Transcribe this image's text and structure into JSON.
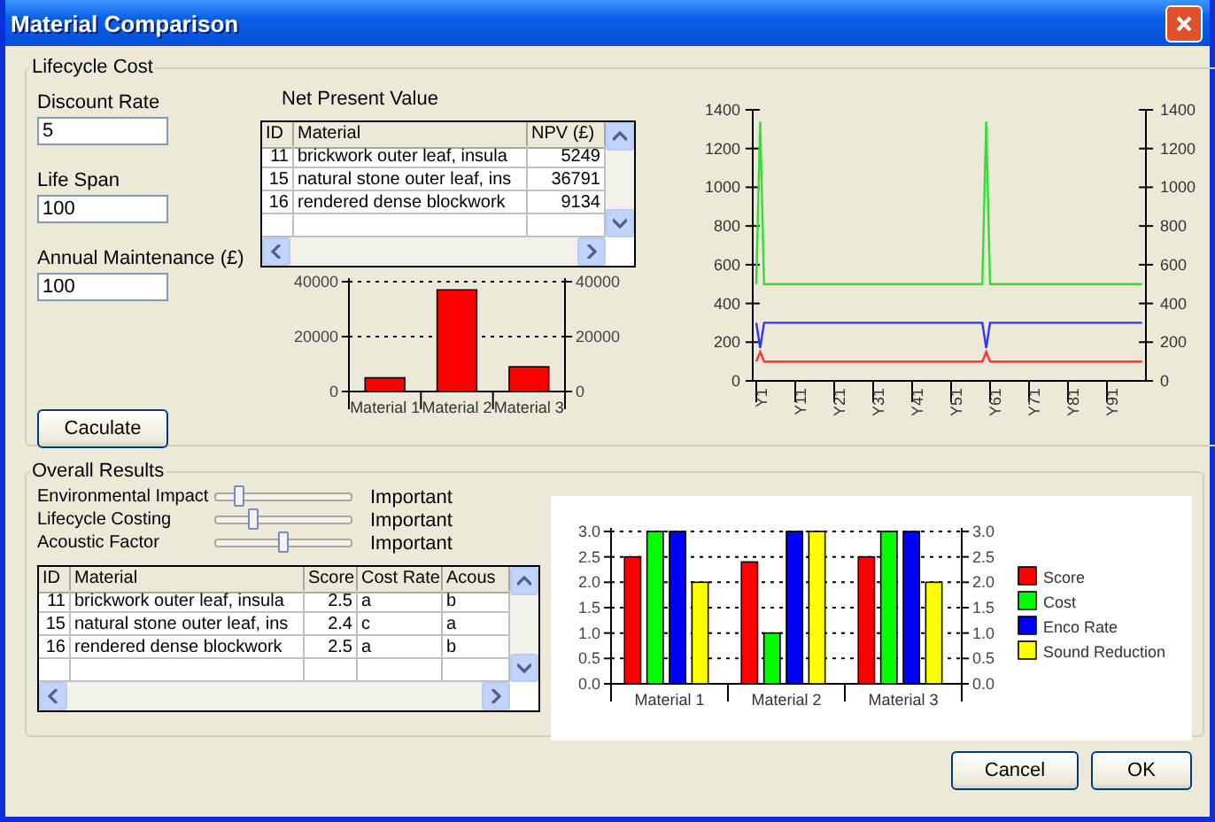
{
  "window": {
    "title": "Material Comparison"
  },
  "lifecycle_cost": {
    "title": "Lifecycle Cost",
    "fields": [
      {
        "label": "Discount Rate",
        "value": "5"
      },
      {
        "label": "Life Span",
        "value": "100"
      },
      {
        "label": "Annual Maintenance (£)",
        "value": "100"
      }
    ],
    "calculate_button": "Caculate",
    "npv_title": "Net Present Value",
    "npv_table": {
      "columns": [
        "ID",
        "Material",
        "NPV (£)"
      ],
      "rows": [
        [
          "11",
          "brickwork outer leaf, insula",
          "5249"
        ],
        [
          "15",
          "natural stone outer leaf, ins",
          "36791"
        ],
        [
          "16",
          "rendered dense blockwork",
          "9134"
        ]
      ]
    },
    "npv_chart": {
      "chart_data": {
        "type": "bar",
        "categories": [
          "Material 1",
          "Material 2",
          "Material 3"
        ],
        "series": [
          {
            "color": "#ff0000",
            "values": [
              5000,
              37000,
              9000
            ]
          }
        ],
        "ylim": [
          0,
          40000
        ],
        "yticks": [
          0,
          20000,
          40000
        ],
        "y2lim": [
          0,
          40000
        ],
        "y2ticks": [
          0,
          20000,
          40000
        ],
        "grid": true
      }
    },
    "trend_chart": {
      "chart_data": {
        "type": "line",
        "ylim": [
          0,
          1400
        ],
        "yticks": [
          0,
          200,
          400,
          600,
          800,
          1000,
          1200,
          1400
        ],
        "y2lim": [
          0,
          1400
        ],
        "y2ticks": [
          0,
          200,
          400,
          600,
          800,
          1000,
          1200,
          1400
        ],
        "categories": [
          "Y1",
          null,
          null,
          null,
          null,
          null,
          null,
          null,
          null,
          null,
          "Y11",
          null,
          null,
          null,
          null,
          null,
          null,
          null,
          null,
          null,
          "Y21",
          null,
          null,
          null,
          null,
          null,
          null,
          null,
          null,
          null,
          "Y31",
          null,
          null,
          null,
          null,
          null,
          null,
          null,
          null,
          null,
          "Y41",
          null,
          null,
          null,
          null,
          null,
          null,
          null,
          null,
          null,
          "Y51",
          null,
          null,
          null,
          null,
          null,
          null,
          null,
          null,
          null,
          "Y61",
          null,
          null,
          null,
          null,
          null,
          null,
          null,
          null,
          null,
          "Y71",
          null,
          null,
          null,
          null,
          null,
          null,
          null,
          null,
          null,
          "Y81",
          null,
          null,
          null,
          null,
          null,
          null,
          null,
          null,
          null,
          "Y91",
          null,
          null,
          null,
          null,
          null,
          null,
          null,
          null,
          null
        ],
        "series": [
          {
            "color": "#33dd33",
            "values": [
              500,
              1340,
              500,
              500,
              500,
              500,
              500,
              500,
              500,
              500,
              500,
              500,
              500,
              500,
              500,
              500,
              500,
              500,
              500,
              500,
              500,
              500,
              500,
              500,
              500,
              500,
              500,
              500,
              500,
              500,
              500,
              500,
              500,
              500,
              500,
              500,
              500,
              500,
              500,
              500,
              500,
              500,
              500,
              500,
              500,
              500,
              500,
              500,
              500,
              500,
              500,
              500,
              500,
              500,
              500,
              500,
              500,
              500,
              500,
              1340,
              500,
              500,
              500,
              500,
              500,
              500,
              500,
              500,
              500,
              500,
              500,
              500,
              500,
              500,
              500,
              500,
              500,
              500,
              500,
              500,
              500,
              500,
              500,
              500,
              500,
              500,
              500,
              500,
              500,
              500,
              500,
              500,
              500,
              500,
              500,
              500,
              500,
              500,
              500,
              500
            ]
          },
          {
            "color": "#3333ff",
            "values": [
              300,
              170,
              300,
              300,
              300,
              300,
              300,
              300,
              300,
              300,
              300,
              300,
              300,
              300,
              300,
              300,
              300,
              300,
              300,
              300,
              300,
              300,
              300,
              300,
              300,
              300,
              300,
              300,
              300,
              300,
              300,
              300,
              300,
              300,
              300,
              300,
              300,
              300,
              300,
              300,
              300,
              300,
              300,
              300,
              300,
              300,
              300,
              300,
              300,
              300,
              300,
              300,
              300,
              300,
              300,
              300,
              300,
              300,
              300,
              170,
              300,
              300,
              300,
              300,
              300,
              300,
              300,
              300,
              300,
              300,
              300,
              300,
              300,
              300,
              300,
              300,
              300,
              300,
              300,
              300,
              300,
              300,
              300,
              300,
              300,
              300,
              300,
              300,
              300,
              300,
              300,
              300,
              300,
              300,
              300,
              300,
              300,
              300,
              300,
              300
            ]
          },
          {
            "color": "#ff3333",
            "values": [
              100,
              150,
              100,
              100,
              100,
              100,
              100,
              100,
              100,
              100,
              100,
              100,
              100,
              100,
              100,
              100,
              100,
              100,
              100,
              100,
              100,
              100,
              100,
              100,
              100,
              100,
              100,
              100,
              100,
              100,
              100,
              100,
              100,
              100,
              100,
              100,
              100,
              100,
              100,
              100,
              100,
              100,
              100,
              100,
              100,
              100,
              100,
              100,
              100,
              100,
              100,
              100,
              100,
              100,
              100,
              100,
              100,
              100,
              100,
              150,
              100,
              100,
              100,
              100,
              100,
              100,
              100,
              100,
              100,
              100,
              100,
              100,
              100,
              100,
              100,
              100,
              100,
              100,
              100,
              100,
              100,
              100,
              100,
              100,
              100,
              100,
              100,
              100,
              100,
              100,
              100,
              100,
              100,
              100,
              100,
              100,
              100,
              100,
              100,
              100
            ]
          }
        ]
      }
    }
  },
  "overall_results": {
    "title": "Overall Results",
    "weights": [
      {
        "label": "Environmental Impact",
        "level": 0.15,
        "value": "Important"
      },
      {
        "label": "Lifecycle Costing",
        "level": 0.25,
        "value": "Important"
      },
      {
        "label": "Acoustic Factor",
        "level": 0.47,
        "value": "Important"
      }
    ],
    "results_table": {
      "columns": [
        "ID",
        "Material",
        "Score",
        "Cost Rate",
        "Acous"
      ],
      "rows": [
        [
          "11",
          "brickwork outer leaf, insula",
          "2.5",
          "a",
          "b"
        ],
        [
          "15",
          "natural stone outer leaf, ins",
          "2.4",
          "c",
          "a"
        ],
        [
          "16",
          "rendered dense blockwork",
          "2.5",
          "a",
          "b"
        ]
      ]
    },
    "results_chart": {
      "chart_data": {
        "type": "bar",
        "categories": [
          "Material 1",
          "Material 2",
          "Material 3"
        ],
        "ylim": [
          0,
          3
        ],
        "yticks": [
          {
            "value": 0,
            "label": "0.0"
          },
          {
            "value": 0.5,
            "label": "0.5"
          },
          {
            "value": 1,
            "label": "1.0"
          },
          {
            "value": 1.5,
            "label": "1.5"
          },
          {
            "value": 2,
            "label": "2.0"
          },
          {
            "value": 2.5,
            "label": "2.5"
          },
          {
            "value": 3,
            "label": "3.0"
          }
        ],
        "y2ticks": [
          {
            "value": 0,
            "label": "0.0"
          },
          {
            "value": 0.5,
            "label": "0.5"
          },
          {
            "value": 1,
            "label": "1.0"
          },
          {
            "value": 1.5,
            "label": "1.5"
          },
          {
            "value": 2,
            "label": "2.0"
          },
          {
            "value": 2.5,
            "label": "2.5"
          },
          {
            "value": 3,
            "label": "3.0"
          }
        ],
        "y2lim": [
          0,
          3
        ],
        "grid": true,
        "legend": true,
        "series": [
          {
            "name": "Score",
            "color": "#ff0000",
            "values": [
              2.5,
              2.4,
              2.5
            ]
          },
          {
            "name": "Cost",
            "color": "#00ff00",
            "values": [
              3,
              1,
              3
            ]
          },
          {
            "name": "Enco Rate",
            "color": "#0000ff",
            "values": [
              3,
              3,
              3
            ]
          },
          {
            "name": "Sound Reduction",
            "color": "#ffff00",
            "values": [
              2,
              3,
              2
            ]
          }
        ]
      }
    }
  },
  "buttons": [
    "Cancel",
    "OK"
  ]
}
